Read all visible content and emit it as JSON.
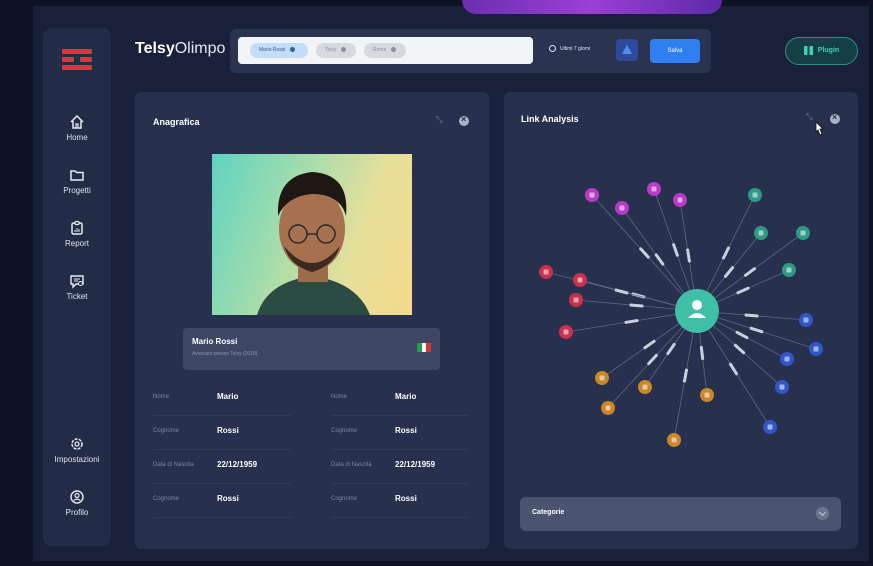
{
  "app": {
    "brand_bold": "Telsy",
    "brand_light": "Olimpo"
  },
  "sidebar": {
    "items": [
      {
        "label": "Home",
        "icon": "home-icon"
      },
      {
        "label": "Progetti",
        "icon": "folder-icon"
      },
      {
        "label": "Report",
        "icon": "clipboard-icon"
      },
      {
        "label": "Ticket",
        "icon": "ticket-icon"
      }
    ],
    "bottom": [
      {
        "label": "Impostazioni",
        "icon": "gear-icon"
      },
      {
        "label": "Profilo",
        "icon": "user-icon"
      }
    ]
  },
  "toolbar": {
    "chips": [
      "Mario Rossi",
      "Telsy",
      "Roma"
    ],
    "date_range": "Ultimi 7 giorni",
    "save_label": "Salva",
    "plugin_label": "Plugin"
  },
  "anagrafica": {
    "title": "Anagrafica",
    "name": "Mario Rossi",
    "subtitle": "Avvocato presso Telsy (2018)",
    "fields": [
      {
        "label": "Nome",
        "value": "Mario"
      },
      {
        "label": "Nome",
        "value": "Mario"
      },
      {
        "label": "Cognome",
        "value": "Rossi"
      },
      {
        "label": "Cognome",
        "value": "Rossi"
      },
      {
        "label": "Data di Nascita",
        "value": "22/12/1959"
      },
      {
        "label": "Data di Nascita",
        "value": "22/12/1959"
      },
      {
        "label": "Cognome",
        "value": "Rossi"
      },
      {
        "label": "Cognome",
        "value": "Rossi"
      }
    ]
  },
  "link_analysis": {
    "title": "Link Analysis",
    "categories_label": "Categorie",
    "node_colors": [
      "#b93bc8",
      "#c8324f",
      "#2e9a84",
      "#3357c9",
      "#c9862a"
    ]
  },
  "colors": {
    "accent_red": "#e3303f",
    "accent_blue": "#2f7ff0",
    "accent_teal": "#3fd0b2"
  }
}
